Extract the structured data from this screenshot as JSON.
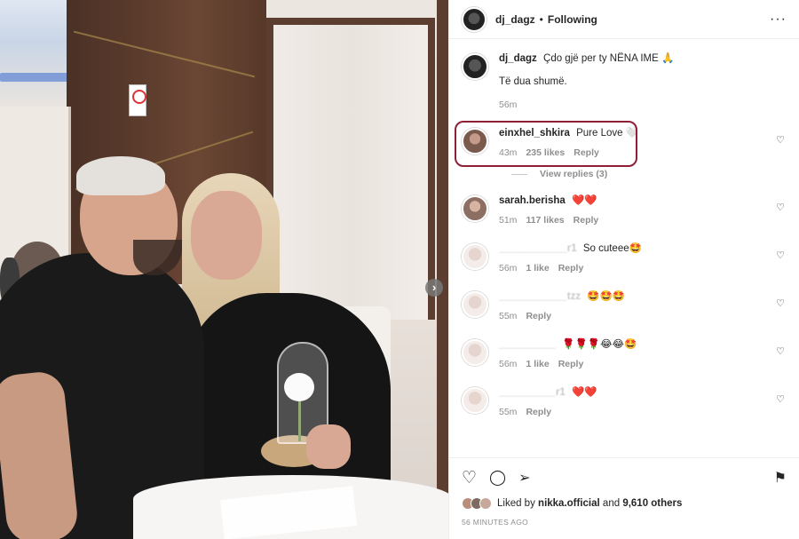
{
  "header": {
    "username": "dj_dagz",
    "separator": "•",
    "follow_state": "Following",
    "more_glyph": "···"
  },
  "caption": {
    "username": "dj_dagz",
    "text": "Çdo gjë per ty NËNA IME 🙏",
    "text2": "Të dua shumë.",
    "time": "56m"
  },
  "comments": [
    {
      "username": "einxhel_shkira",
      "text": "Pure Love 🤍",
      "time": "43m",
      "likes": "235 likes",
      "reply": "Reply",
      "view_replies": "View replies (3)",
      "highlighted": true
    },
    {
      "username": "sarah.berisha",
      "text": "❤️❤️",
      "time": "51m",
      "likes": "117 likes",
      "reply": "Reply"
    },
    {
      "username": "____________r1",
      "text": "So cuteee🤩",
      "time": "56m",
      "likes": "1 like",
      "reply": "Reply"
    },
    {
      "username": "____________tzz",
      "text": "🤩🤩🤩",
      "time": "55m",
      "likes": "",
      "reply": "Reply"
    },
    {
      "username": "__________",
      "text": "🌹🌹🌹😂😂🤩",
      "time": "56m",
      "likes": "1 like",
      "reply": "Reply"
    },
    {
      "username": "__________r1",
      "text": "❤️❤️",
      "time": "55m",
      "likes": "",
      "reply": "Reply"
    }
  ],
  "icons": {
    "heart": "♡",
    "like": "♡",
    "comment": "◯",
    "share": "➢",
    "save": "⚑",
    "next": "›"
  },
  "likes": {
    "prefix": "Liked by",
    "user": "nikka.official",
    "and": "and",
    "count": "9,610 others"
  },
  "timestamp": "56 MINUTES AGO",
  "colors": {
    "highlight": "#8f1f34",
    "muted": "#8e8e8e",
    "heart": "#e0245e"
  }
}
